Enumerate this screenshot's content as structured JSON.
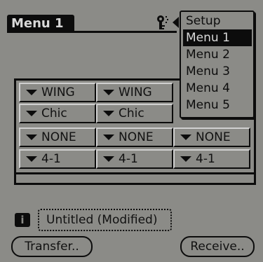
{
  "window": {
    "title": "Menu 1"
  },
  "menu": {
    "items": [
      "Setup",
      "Menu 1",
      "Menu 2",
      "Menu 3",
      "Menu 4",
      "Menu 5"
    ],
    "selected": "Menu 1"
  },
  "grid": {
    "rows": [
      [
        "WING",
        "WING",
        ""
      ],
      [
        "Chic",
        "Chic",
        ""
      ],
      [
        "NONE",
        "NONE",
        "NONE"
      ],
      [
        "4-1",
        "4-1",
        "4-1"
      ]
    ]
  },
  "document": {
    "name": "Untitled (Modified)"
  },
  "buttons": {
    "transfer": "Transfer..",
    "receive": "Receive.."
  },
  "icons": {
    "key": "key-icon",
    "info": "info-icon",
    "dropdown_arrow": "triangle-down-icon",
    "back_arrow": "triangle-left-icon"
  }
}
